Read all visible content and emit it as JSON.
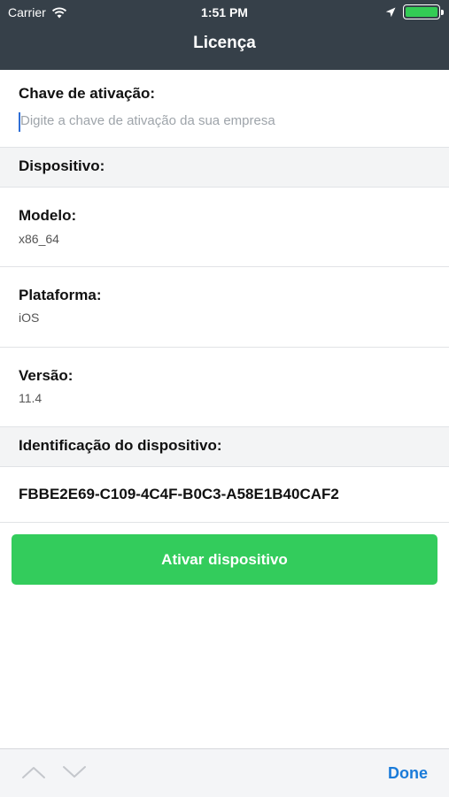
{
  "status_bar": {
    "carrier": "Carrier",
    "time": "1:51 PM",
    "battery_percent": 100
  },
  "nav": {
    "title": "Licença"
  },
  "activation": {
    "label": "Chave de ativação:",
    "placeholder": "Digite a chave de ativação da sua empresa",
    "value": ""
  },
  "device_section": {
    "header": "Dispositivo:"
  },
  "model": {
    "label": "Modelo:",
    "value": "x86_64"
  },
  "platform": {
    "label": "Plataforma:",
    "value": "iOS"
  },
  "version": {
    "label": "Versão:",
    "value": "11.4"
  },
  "device_id": {
    "header": "Identificação do dispositivo:",
    "value": "FBBE2E69-C109-4C4F-B0C3-A58E1B40CAF2"
  },
  "actions": {
    "activate_label": "Ativar dispositivo"
  },
  "keyboard_toolbar": {
    "prev_icon": "chevron-up-icon",
    "next_icon": "chevron-down-icon",
    "done_label": "Done"
  },
  "colors": {
    "header_bg": "#364049",
    "accent_green": "#33cc5c",
    "done_blue": "#1a7bd9"
  }
}
